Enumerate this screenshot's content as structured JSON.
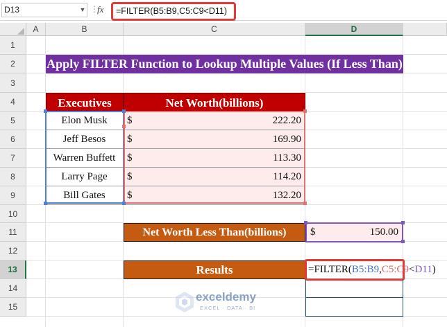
{
  "formula_bar": {
    "name_box": "D13",
    "fx_label": "fx",
    "formula": "=FILTER(B5:B9,C5:C9<D11)"
  },
  "column_headers": [
    "A",
    "B",
    "C",
    "D"
  ],
  "selected_column": "D",
  "row_headers": [
    "1",
    "2",
    "3",
    "4",
    "5",
    "6",
    "7",
    "8",
    "9",
    "10",
    "11",
    "12",
    "13",
    "14",
    "15"
  ],
  "selected_row": "13",
  "sheet": {
    "title": "Apply FILTER Function to Lookup Multiple Values (If Less Than)",
    "table_headers": {
      "executives": "Executives",
      "net_worth": "Net Worth(billions)"
    },
    "rows": [
      {
        "executive": "Elon Musk",
        "currency": "$",
        "value": "222.20"
      },
      {
        "executive": "Jeff Besos",
        "currency": "$",
        "value": "169.90"
      },
      {
        "executive": "Warren Buffett",
        "currency": "$",
        "value": "113.30"
      },
      {
        "executive": "Larry Page",
        "currency": "$",
        "value": "114.20"
      },
      {
        "executive": "Bill Gates",
        "currency": "$",
        "value": "132.20"
      }
    ],
    "threshold_label": "Net Worth Less Than(billions)",
    "threshold": {
      "currency": "$",
      "value": "150.00"
    },
    "results_label": "Results",
    "results_formula": {
      "prefix": "=FILTER(",
      "ref1": "B5:B9",
      "sep1": ",",
      "ref2": "C5:C9",
      "op": "<",
      "ref3": "D11",
      "suffix": ")"
    }
  },
  "watermark": {
    "name": "exceldemy",
    "tagline": "EXCEL · DATA · BI"
  },
  "colors": {
    "title_bg": "#7030a0",
    "header_bg": "#c00000",
    "label_bg": "#c55a11",
    "ref_blue": "#4472c4",
    "ref_red": "#e06666",
    "ref_purple": "#7e57c2",
    "highlight_red": "#e53935"
  }
}
